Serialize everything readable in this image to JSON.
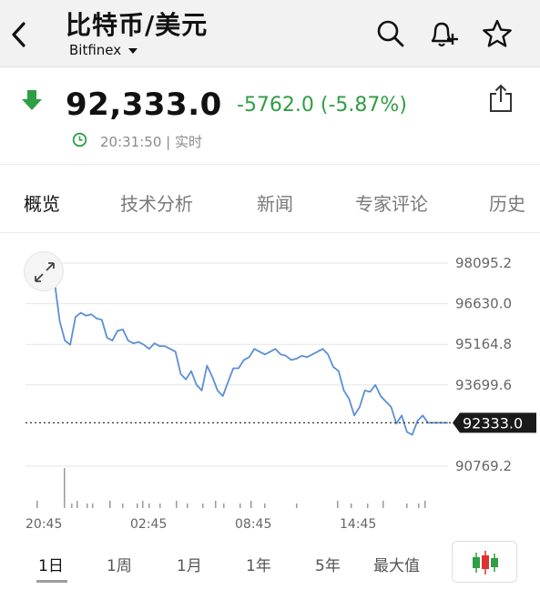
{
  "header": {
    "title": "比特币/美元",
    "exchange": "Bitfinex"
  },
  "quote": {
    "price": "92,333.0",
    "change": "-5762.0 (-5.87%)",
    "time": "20:31:50 | 实时",
    "change_color": "#2f9e44"
  },
  "tabs": [
    {
      "label": "概览",
      "active": true
    },
    {
      "label": "技术分析"
    },
    {
      "label": "新闻"
    },
    {
      "label": "专家评论"
    },
    {
      "label": "历史"
    }
  ],
  "periods": [
    {
      "label": "1日",
      "active": true
    },
    {
      "label": "1周"
    },
    {
      "label": "1月"
    },
    {
      "label": "1年"
    },
    {
      "label": "5年"
    },
    {
      "label": "最大值"
    }
  ],
  "chart_data": {
    "type": "line",
    "y_ticks": [
      "98095.2",
      "96630.0",
      "95164.8",
      "93699.6",
      "90769.2"
    ],
    "x_ticks": [
      "20:45",
      "02:45",
      "08:45",
      "14:45"
    ],
    "current_label": "92333.0",
    "current_value": 92333.0,
    "ylim": [
      89304.0,
      98095.2
    ],
    "line_color": "#5b8fd6",
    "x": [
      0,
      1,
      2,
      3,
      4,
      5,
      6,
      7,
      8,
      9,
      10,
      11,
      12,
      13,
      14,
      15,
      16,
      17,
      18,
      19,
      20,
      21,
      22,
      23,
      24,
      25,
      26,
      27,
      28,
      29,
      30,
      31,
      32,
      33,
      34,
      35,
      36,
      37,
      38,
      39,
      40,
      41,
      42,
      43,
      44,
      45,
      46,
      47,
      48,
      49,
      50,
      51,
      52,
      53,
      54,
      55,
      56,
      57,
      58,
      59,
      60,
      61,
      62,
      63,
      64,
      65,
      66,
      67,
      68,
      69,
      70,
      71,
      72,
      73,
      74,
      75,
      76,
      77,
      78,
      79,
      80,
      81,
      82,
      83,
      84,
      85,
      86,
      87
    ],
    "values": [
      97750,
      97450,
      96000,
      95300,
      95150,
      96150,
      96300,
      96200,
      96250,
      96100,
      96050,
      95400,
      95300,
      95650,
      95700,
      95300,
      95200,
      95250,
      95150,
      95000,
      95200,
      95100,
      95100,
      95000,
      94900,
      94100,
      93900,
      94200,
      93700,
      93500,
      94400,
      94000,
      93500,
      93300,
      93800,
      94300,
      94300,
      94600,
      94700,
      95000,
      94900,
      94800,
      94900,
      95000,
      94800,
      94750,
      94600,
      94650,
      94750,
      94700,
      94800,
      94900,
      95000,
      94800,
      94350,
      94200,
      93500,
      93200,
      92600,
      92900,
      93500,
      93450,
      93700,
      93300,
      93100,
      92900,
      92300,
      92600,
      92000,
      91900,
      92400,
      92600,
      92333
    ]
  }
}
